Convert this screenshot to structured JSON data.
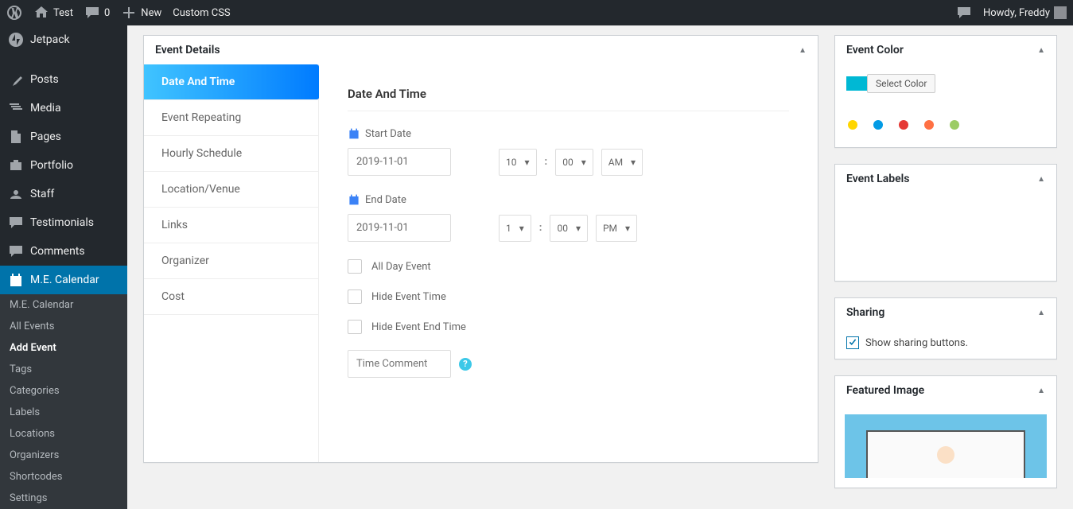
{
  "adminbar": {
    "site": "Test",
    "comments": "0",
    "new": "New",
    "customcss": "Custom CSS",
    "howdy": "Howdy, Freddy"
  },
  "menu": {
    "jetpack": "Jetpack",
    "posts": "Posts",
    "media": "Media",
    "pages": "Pages",
    "portfolio": "Portfolio",
    "staff": "Staff",
    "testimonials": "Testimonials",
    "comments": "Comments",
    "mecalendar": "M.E. Calendar"
  },
  "submenu": {
    "mecalendar": "M.E. Calendar",
    "allevents": "All Events",
    "addevent": "Add Event",
    "tags": "Tags",
    "categories": "Categories",
    "labels": "Labels",
    "locations": "Locations",
    "organizers": "Organizers",
    "shortcodes": "Shortcodes",
    "settings": "Settings"
  },
  "details": {
    "title": "Event Details",
    "tabs": {
      "datetime": "Date And Time",
      "repeat": "Event Repeating",
      "hourly": "Hourly Schedule",
      "location": "Location/Venue",
      "links": "Links",
      "organizer": "Organizer",
      "cost": "Cost"
    }
  },
  "dt": {
    "heading": "Date And Time",
    "start": "Start Date",
    "end": "End Date",
    "startdate": "2019-11-01",
    "enddate": "2019-11-01",
    "sh": "10",
    "sm": "00",
    "sap": "AM",
    "eh": "1",
    "em": "00",
    "eap": "PM",
    "allday": "All Day Event",
    "hidetime": "Hide Event Time",
    "hideend": "Hide Event End Time",
    "timecomment_ph": "Time Comment"
  },
  "side": {
    "eventcolor": "Event Color",
    "selectcolor": "Select Color",
    "dots": [
      "#ffd600",
      "#039be5",
      "#e53935",
      "#ff7043",
      "#9ccc65"
    ],
    "eventlabels": "Event Labels",
    "sharing": "Sharing",
    "showsharing": "Show sharing buttons.",
    "featured": "Featured Image"
  }
}
